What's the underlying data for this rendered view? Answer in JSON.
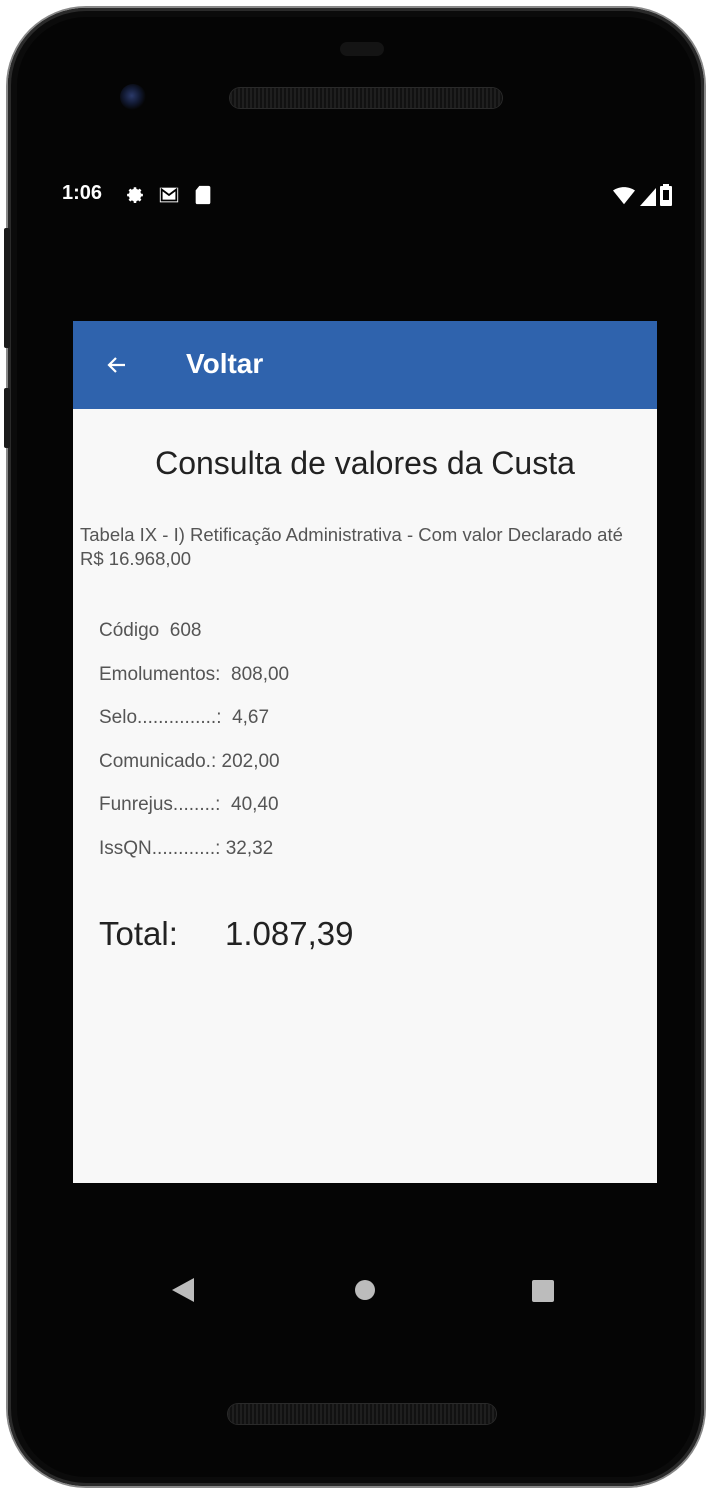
{
  "status_bar": {
    "time": "1:06"
  },
  "app_bar": {
    "back_icon": "arrow-left-icon",
    "title": "Voltar"
  },
  "content": {
    "heading": "Consulta de valores da Custa",
    "description": "Tabela IX - I) Retificação Administrativa - Com valor Declarado até R$ 16.968,00",
    "rows": [
      {
        "label": "Código",
        "value": "608"
      },
      {
        "label": "Emolumentos:",
        "value": "808,00"
      },
      {
        "label": "Selo...............:",
        "value": "4,67"
      },
      {
        "label": "Comunicado.:",
        "value": "202,00"
      },
      {
        "label": "Funrejus........:",
        "value": "40,40"
      },
      {
        "label": "IssQN............:",
        "value": "32,32"
      }
    ],
    "total_label": "Total:",
    "total_value": "1.087,39"
  },
  "colors": {
    "app_bar": "#2f63ad",
    "background": "#f8f8f8"
  }
}
